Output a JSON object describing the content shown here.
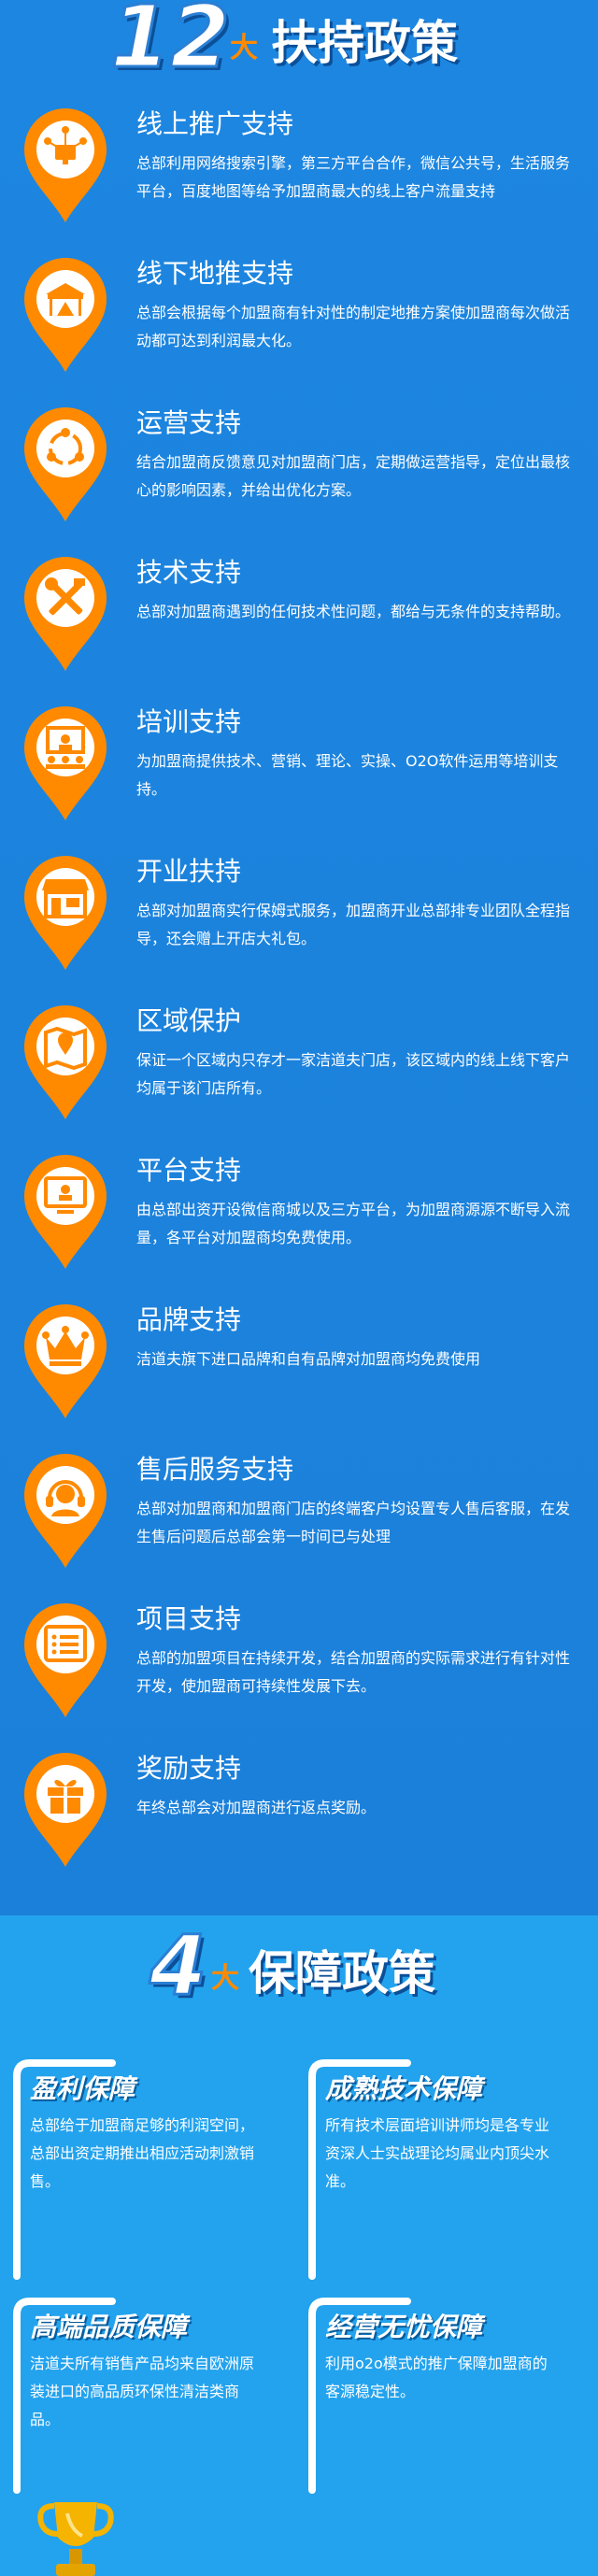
{
  "colors": {
    "orange": "#ff8a00",
    "blue": "#1b82dd",
    "light_blue": "#23a3ee",
    "white": "#ffffff"
  },
  "header_12": {
    "number": "12",
    "da": "大",
    "title": "扶持政策"
  },
  "policies": [
    {
      "title": "线上推广支持",
      "desc": "总部利用网络搜索引擎，第三方平台合作，微信公共号，生活服务平台，百度地图等给予加盟商最大的线上客户流量支持",
      "icon": "network-icon"
    },
    {
      "title": "线下地推支持",
      "desc": "总部会根据每个加盟商有针对性的制定地推方案使加盟商每次做活动都可达到利润最大化。",
      "icon": "tent-icon"
    },
    {
      "title": "运营支持",
      "desc": "结合加盟商反馈意见对加盟商门店，定期做运营指导，定位出最核心的影响因素，并给出优化方案。",
      "icon": "cycle-icon"
    },
    {
      "title": "技术支持",
      "desc": "总部对加盟商遇到的任何技术性问题，都给与无条件的支持帮助。",
      "icon": "tools-icon"
    },
    {
      "title": "培训支持",
      "desc": "为加盟商提供技术、营销、理论、实操、O2O软件运用等培训支持。",
      "icon": "training-icon"
    },
    {
      "title": "开业扶持",
      "desc": "总部对加盟商实行保姆式服务，加盟商开业总部排专业团队全程指导，还会赠上开店大礼包。",
      "icon": "store-icon"
    },
    {
      "title": "区域保护",
      "desc": "保证一个区域内只存才一家洁道夫门店，该区域内的线上线下客户均属于该门店所有。",
      "icon": "map-pin-icon"
    },
    {
      "title": "平台支持",
      "desc": "由总部出资开设微信商城以及三方平台，为加盟商源源不断导入流量，各平台对加盟商均免费使用。",
      "icon": "monitor-icon"
    },
    {
      "title": "品牌支持",
      "desc": "洁道夫旗下进口品牌和自有品牌对加盟商均免费使用",
      "icon": "crown-icon"
    },
    {
      "title": "售后服务支持",
      "desc": "总部对加盟商和加盟商门店的终端客户均设置专人售后客服，在发生售后问题后总部会第一时间已与处理",
      "icon": "headset-icon"
    },
    {
      "title": "项目支持",
      "desc": "总部的加盟项目在持续开发，结合加盟商的实际需求进行有针对性开发，使加盟商可持续性发展下去。",
      "icon": "list-icon"
    },
    {
      "title": "奖励支持",
      "desc": "年终总部会对加盟商进行返点奖励。",
      "icon": "gift-icon"
    }
  ],
  "header_4": {
    "number": "4",
    "da": "大",
    "title": "保障政策"
  },
  "guarantees": [
    {
      "title": "盈利保障",
      "desc": "总部给于加盟商足够的利润空间，总部出资定期推出相应活动刺激销售。"
    },
    {
      "title": "成熟技术保障",
      "desc": "所有技术层面培训讲师均是各专业资深人士实战理论均属业内顶尖水准。"
    },
    {
      "title": "高端品质保障",
      "desc": "洁道夫所有销售产品均来自欧洲原装进口的高品质环保性清洁类商品。"
    },
    {
      "title": "经营无忧保障",
      "desc": "利用o2o模式的推广保障加盟商的客源稳定性。"
    }
  ],
  "trophy_icon": "trophy-icon"
}
